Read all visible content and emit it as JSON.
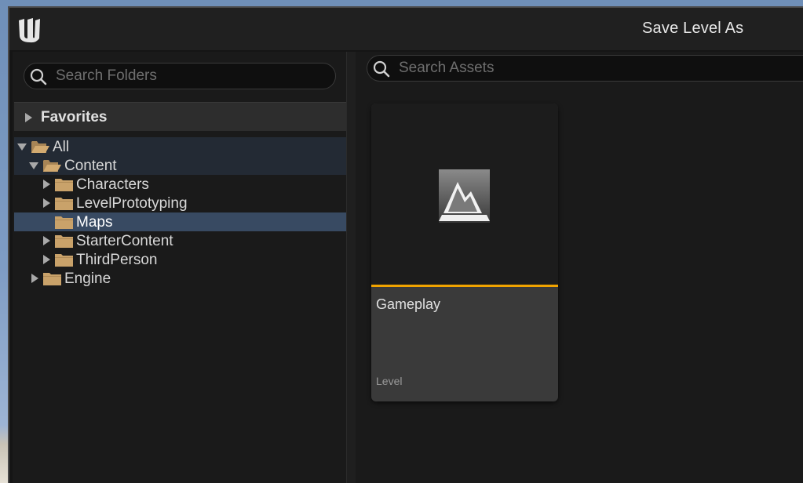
{
  "window": {
    "title": "Save Level As"
  },
  "folders_search": {
    "placeholder": "Search Folders",
    "value": ""
  },
  "assets_search": {
    "placeholder": "Search Assets",
    "value": ""
  },
  "favorites": {
    "label": "Favorites",
    "expanded": false
  },
  "tree": {
    "all": "All",
    "content": "Content",
    "characters": "Characters",
    "level_prototyping": "LevelPrototyping",
    "maps": "Maps",
    "starter_content": "StarterContent",
    "third_person": "ThirdPerson",
    "engine": "Engine"
  },
  "asset": {
    "name": "Gameplay",
    "type": "Level",
    "icon": "level-icon",
    "accent_color": "#f0a300"
  },
  "colors": {
    "selection": "#384a62",
    "folder": "#c9a26a"
  },
  "icons": [
    "unreal-logo-icon",
    "search-icon",
    "folder-icon",
    "folder-open-icon",
    "expand-arrow-icon",
    "collapse-arrow-icon",
    "level-icon"
  ]
}
